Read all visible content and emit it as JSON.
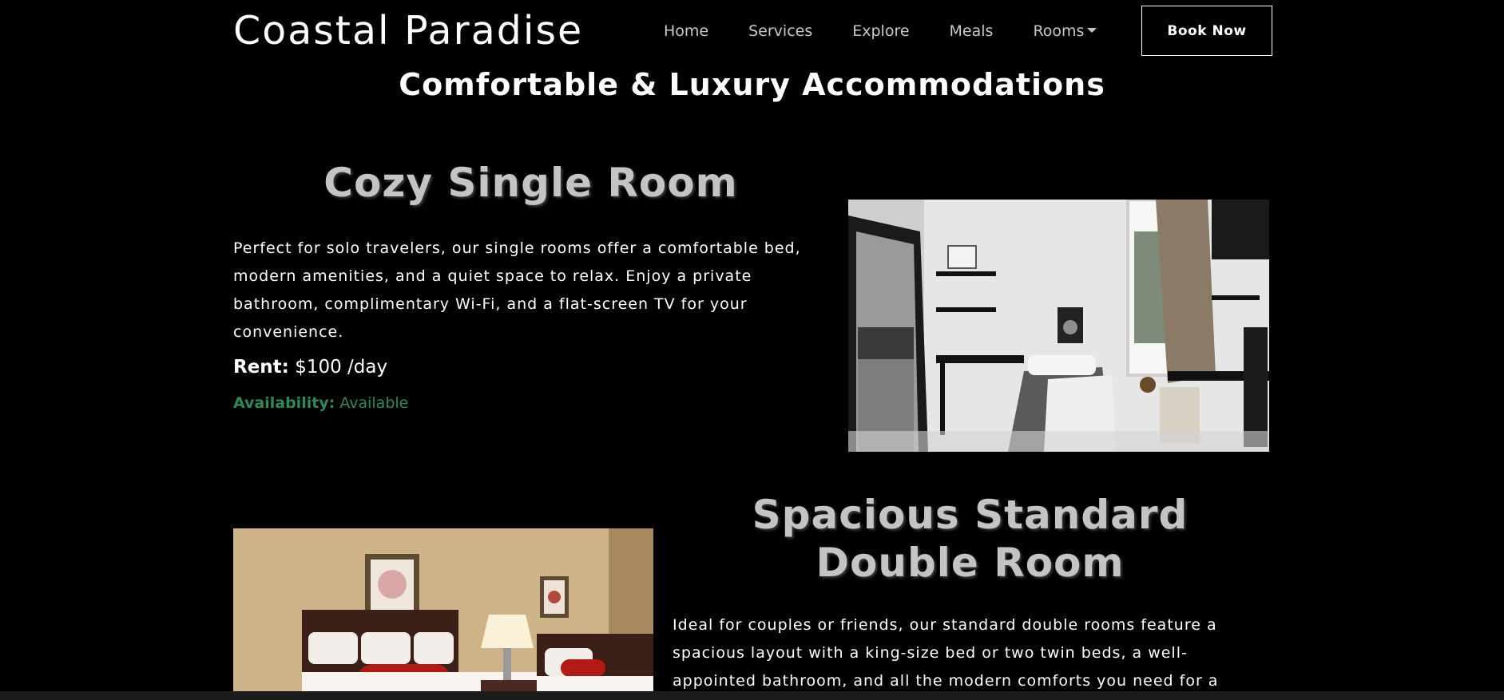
{
  "nav": {
    "brand": "Coastal Paradise",
    "links": [
      "Home",
      "Services",
      "Explore",
      "Meals",
      "Rooms"
    ],
    "book_label": "Book Now"
  },
  "page": {
    "heading": "Comfortable & Luxury Accommodations"
  },
  "rooms": [
    {
      "title": "Cozy Single Room",
      "description": "Perfect for solo travelers, our single rooms offer a comfortable bed, modern amenities, and a quiet space to relax. Enjoy a private bathroom, complimentary Wi-Fi, and a flat-screen TV for your convenience.",
      "rent_label": "Rent:",
      "rent_value": "$100 /day",
      "availability_label": "Availability:",
      "availability_value": "Available"
    },
    {
      "title": "Spacious Standard Double Room",
      "description": "Ideal for couples or friends, our standard double rooms feature a spacious layout with a king-size bed or two twin beds, a well-appointed bathroom, and all the modern comforts you need for a"
    }
  ],
  "colors": {
    "background": "#000000",
    "availability": "#2e8b57",
    "room_title": "#c4c4c4"
  }
}
